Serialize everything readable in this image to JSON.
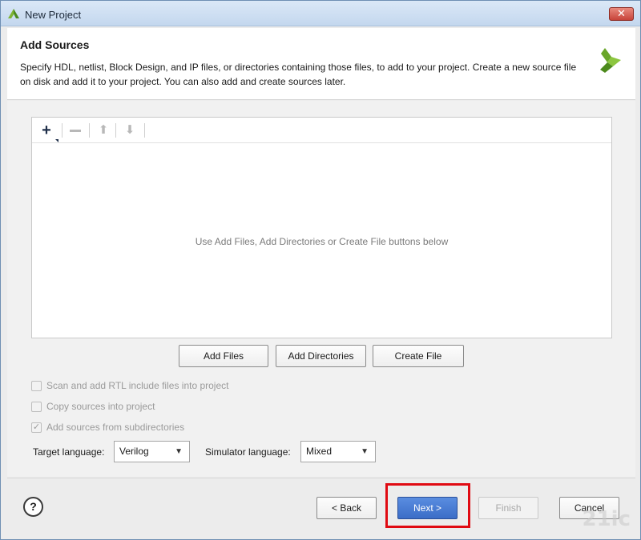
{
  "window": {
    "title": "New Project",
    "close_glyph": "✕"
  },
  "header": {
    "title": "Add Sources",
    "description": "Specify HDL, netlist, Block Design, and IP files, or directories containing those files, to add to your project. Create a new source file on disk and add it to your project. You can also add and create sources later."
  },
  "toolbar": {
    "add_icon": "plus-icon",
    "remove_icon": "minus-icon",
    "up_icon": "arrow-up-icon",
    "down_icon": "arrow-down-icon"
  },
  "file_panel": {
    "empty_hint": "Use Add Files, Add Directories or Create File buttons below"
  },
  "actions": {
    "add_files": "Add Files",
    "add_directories": "Add Directories",
    "create_file": "Create File"
  },
  "options": [
    {
      "label": "Scan and add RTL include files into project",
      "checked": false
    },
    {
      "label": "Copy sources into project",
      "checked": false
    },
    {
      "label": "Add sources from subdirectories",
      "checked": true
    }
  ],
  "language": {
    "target_label": "Target language:",
    "target_value": "Verilog",
    "simulator_label": "Simulator language:",
    "simulator_value": "Mixed"
  },
  "footer": {
    "help": "?",
    "back": "< Back",
    "next": "Next >",
    "finish": "Finish",
    "cancel": "Cancel"
  },
  "watermark": "21ic",
  "colors": {
    "primary": "#3b6dc7",
    "highlight": "#e00a12"
  }
}
